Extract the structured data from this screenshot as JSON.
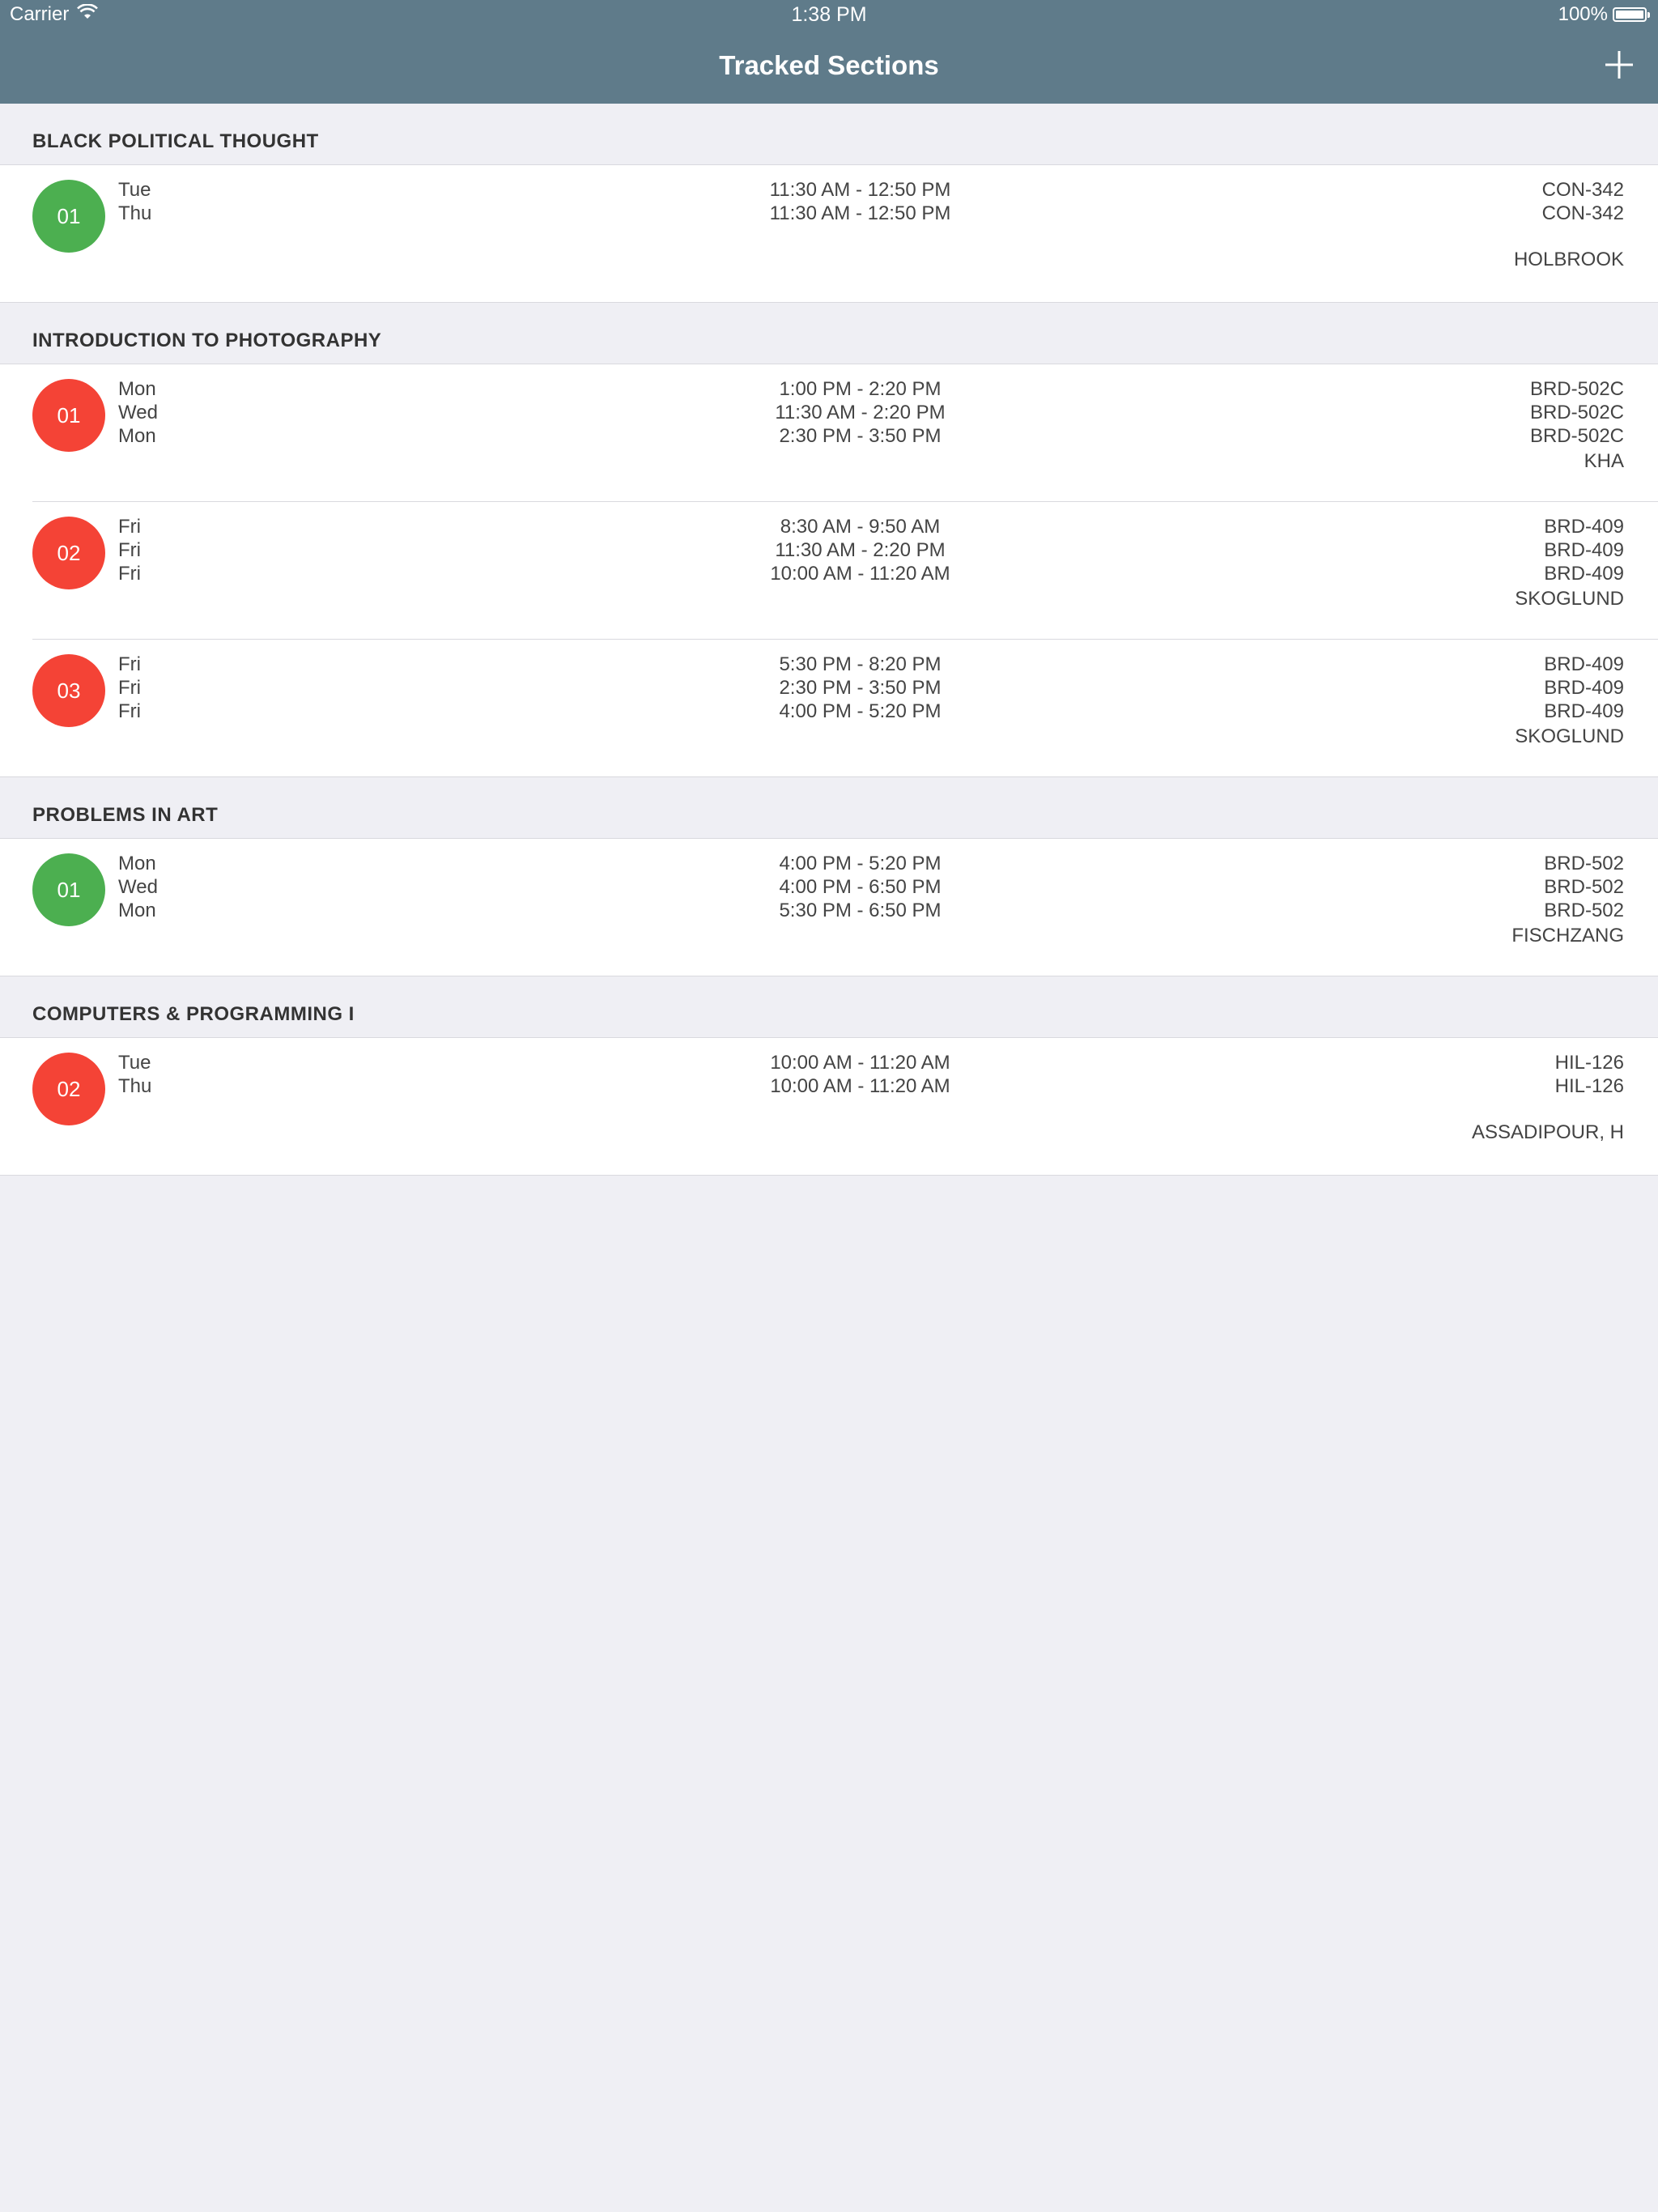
{
  "status_bar": {
    "carrier": "Carrier",
    "time": "1:38 PM",
    "battery": "100%"
  },
  "nav": {
    "title": "Tracked Sections"
  },
  "colors": {
    "nav_bg": "#5f7b8a",
    "open": "#4caf50",
    "closed": "#f44336"
  },
  "courses": [
    {
      "title": "BLACK POLITICAL THOUGHT",
      "sections": [
        {
          "number": "01",
          "status": "open",
          "days": [
            "Tue",
            "Thu"
          ],
          "times": [
            "11:30 AM - 12:50 PM",
            "11:30 AM - 12:50 PM"
          ],
          "rooms": [
            "CON-342",
            "CON-342"
          ],
          "instructor": "HOLBROOK"
        }
      ]
    },
    {
      "title": "INTRODUCTION TO PHOTOGRAPHY",
      "sections": [
        {
          "number": "01",
          "status": "closed",
          "days": [
            "Mon",
            "Wed",
            "Mon"
          ],
          "times": [
            "1:00 PM - 2:20 PM",
            "11:30 AM - 2:20 PM",
            "2:30 PM - 3:50 PM"
          ],
          "rooms": [
            "BRD-502C",
            "BRD-502C",
            "BRD-502C"
          ],
          "instructor": "KHA"
        },
        {
          "number": "02",
          "status": "closed",
          "days": [
            "Fri",
            "Fri",
            "Fri"
          ],
          "times": [
            "8:30 AM - 9:50 AM",
            "11:30 AM - 2:20 PM",
            "10:00 AM - 11:20 AM"
          ],
          "rooms": [
            "BRD-409",
            "BRD-409",
            "BRD-409"
          ],
          "instructor": "SKOGLUND"
        },
        {
          "number": "03",
          "status": "closed",
          "days": [
            "Fri",
            "Fri",
            "Fri"
          ],
          "times": [
            "5:30 PM - 8:20 PM",
            "2:30 PM - 3:50 PM",
            "4:00 PM - 5:20 PM"
          ],
          "rooms": [
            "BRD-409",
            "BRD-409",
            "BRD-409"
          ],
          "instructor": "SKOGLUND"
        }
      ]
    },
    {
      "title": "PROBLEMS IN ART",
      "sections": [
        {
          "number": "01",
          "status": "open",
          "days": [
            "Mon",
            "Wed",
            "Mon"
          ],
          "times": [
            "4:00 PM - 5:20 PM",
            "4:00 PM - 6:50 PM",
            "5:30 PM - 6:50 PM"
          ],
          "rooms": [
            "BRD-502",
            "BRD-502",
            "BRD-502"
          ],
          "instructor": "FISCHZANG"
        }
      ]
    },
    {
      "title": "COMPUTERS & PROGRAMMING I",
      "sections": [
        {
          "number": "02",
          "status": "closed",
          "days": [
            "Tue",
            "Thu"
          ],
          "times": [
            "10:00 AM - 11:20 AM",
            "10:00 AM - 11:20 AM"
          ],
          "rooms": [
            "HIL-126",
            "HIL-126"
          ],
          "instructor": "ASSADIPOUR, H"
        }
      ]
    }
  ]
}
